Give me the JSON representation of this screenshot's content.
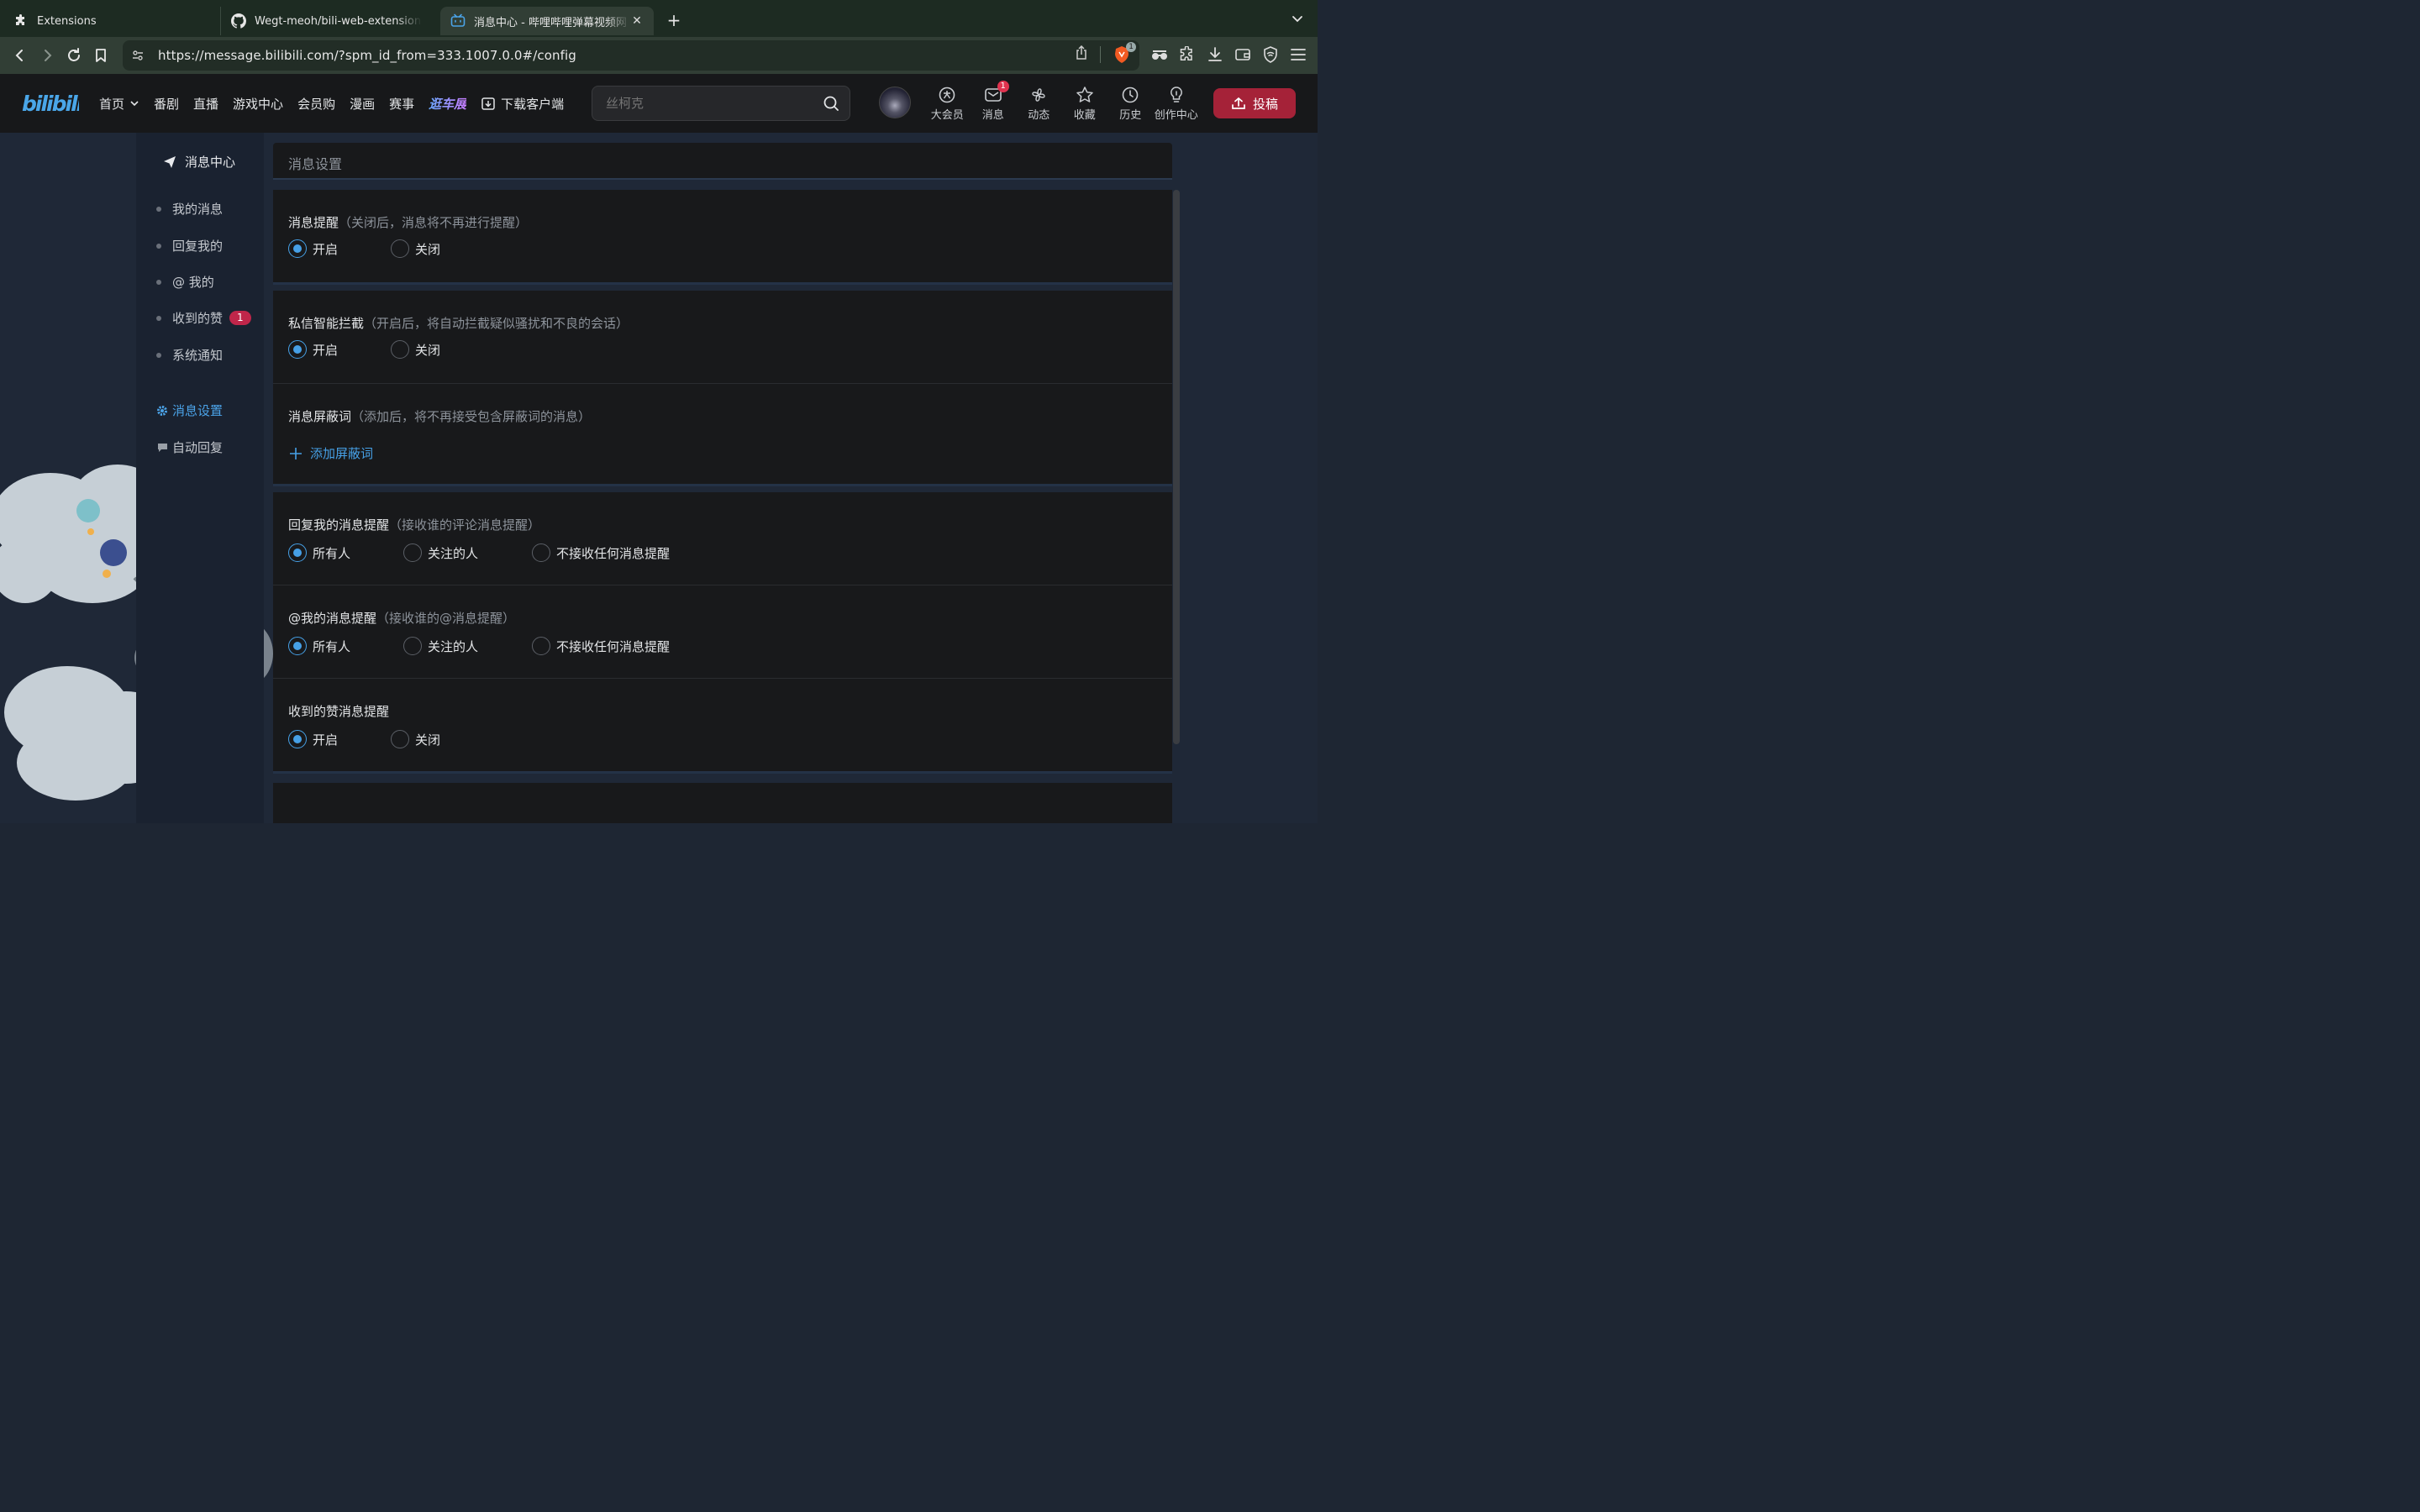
{
  "browser": {
    "tabs": [
      {
        "label": "Extensions"
      },
      {
        "label": "Wegt-meoh/bili-web-extension: A"
      },
      {
        "label": "消息中心 - 哔哩哔哩弹幕视频网"
      }
    ],
    "url": "https://message.bilibili.com/?spm_id_from=333.1007.0.0#/config",
    "shield_count": "1"
  },
  "header": {
    "nav": [
      "首页",
      "番剧",
      "直播",
      "游戏中心",
      "会员购",
      "漫画",
      "赛事"
    ],
    "event_label": "逛车展",
    "download_label": "下载客户端",
    "search_placeholder": "丝柯克",
    "icons": [
      {
        "label": "大会员",
        "icon": "vip-icon"
      },
      {
        "label": "消息",
        "icon": "mail-icon",
        "badge": "1"
      },
      {
        "label": "动态",
        "icon": "pinwheel-icon"
      },
      {
        "label": "收藏",
        "icon": "star-icon"
      },
      {
        "label": "历史",
        "icon": "clock-icon"
      },
      {
        "label": "创作中心",
        "icon": "bulb-icon"
      }
    ],
    "upload_label": "投稿"
  },
  "sidebar": {
    "title": "消息中心",
    "items": [
      {
        "label": "我的消息"
      },
      {
        "label": "回复我的"
      },
      {
        "label": "@ 我的"
      },
      {
        "label": "收到的赞",
        "badge": "1"
      },
      {
        "label": "系统通知"
      }
    ],
    "settings_label": "消息设置",
    "autoreply_label": "自动回复"
  },
  "content": {
    "header": "消息设置",
    "sections": [
      {
        "title": "消息提醒",
        "hint": "（关闭后，消息将不再进行提醒）",
        "options": [
          "开启",
          "关闭"
        ],
        "selected": 0
      },
      {
        "title": "私信智能拦截",
        "hint": "（开启后，将自动拦截疑似骚扰和不良的会话）",
        "options": [
          "开启",
          "关闭"
        ],
        "selected": 0
      },
      {
        "title": "消息屏蔽词",
        "hint": "（添加后，将不再接受包含屏蔽词的消息）",
        "add_label": "添加屏蔽词"
      },
      {
        "title": "回复我的消息提醒",
        "hint": "（接收谁的评论消息提醒）",
        "options": [
          "所有人",
          "关注的人",
          "不接收任何消息提醒"
        ],
        "selected": 0
      },
      {
        "title": "@我的消息提醒",
        "hint": "（接收谁的@消息提醒）",
        "options": [
          "所有人",
          "关注的人",
          "不接收任何消息提醒"
        ],
        "selected": 0
      },
      {
        "title": "收到的赞消息提醒",
        "hint": "",
        "options": [
          "开启",
          "关闭"
        ],
        "selected": 0
      }
    ]
  },
  "colors": {
    "accent": "#46a0e6",
    "upload": "#a52238",
    "badge": "#c0264a"
  }
}
